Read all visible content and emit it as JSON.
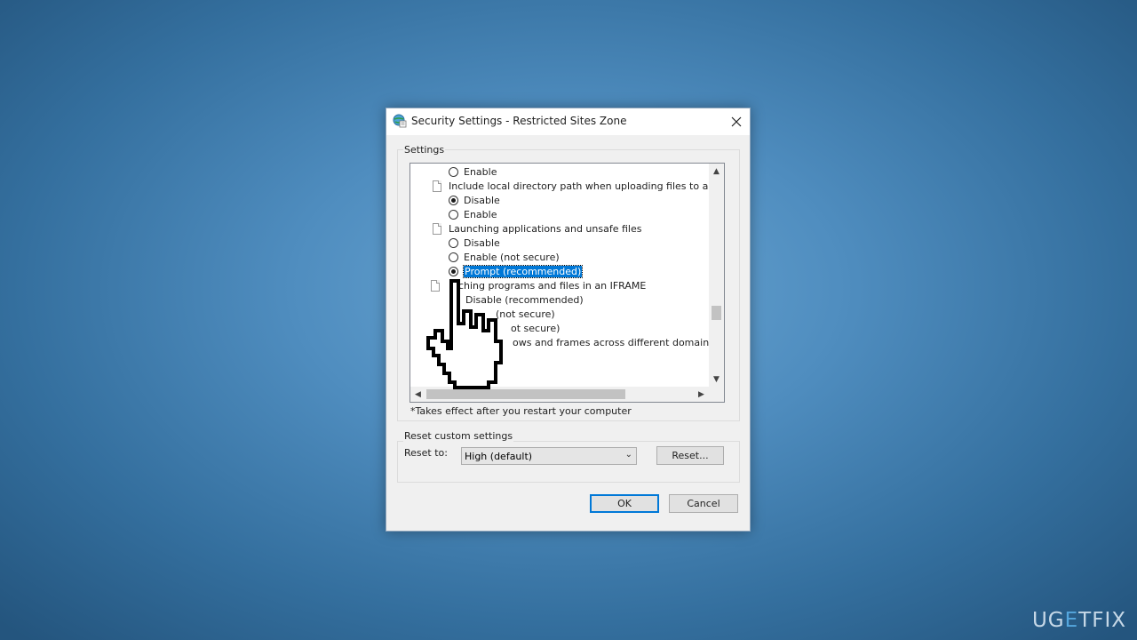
{
  "window": {
    "title": "Security Settings - Restricted Sites Zone"
  },
  "settings_group": {
    "label": "Settings",
    "items": [
      {
        "type": "option",
        "label": "Enable",
        "checked": false
      },
      {
        "type": "category",
        "label": "Include local directory path when uploading files to a server"
      },
      {
        "type": "option",
        "label": "Disable",
        "checked": true
      },
      {
        "type": "option",
        "label": "Enable",
        "checked": false
      },
      {
        "type": "category",
        "label": "Launching applications and unsafe files"
      },
      {
        "type": "option",
        "label": "Disable",
        "checked": false
      },
      {
        "type": "option",
        "label": "Enable (not secure)",
        "checked": false
      },
      {
        "type": "option",
        "label": "Prompt (recommended)",
        "checked": true,
        "selected": true
      },
      {
        "type": "category",
        "label": "Launching programs and files in an IFRAME"
      },
      {
        "type": "option",
        "label": "Disable (recommended)",
        "checked": false
      },
      {
        "type": "option",
        "label": "Enable (not secure)",
        "checked": false
      },
      {
        "type": "option",
        "label": "Prompt (not secure)",
        "checked": false
      },
      {
        "type": "category",
        "label": "Navigate windows and frames across different domains"
      }
    ],
    "visible_text": {
      "item_8": "nching programs and files in an IFRAME",
      "item_9": "Disable (recommended)",
      "item_10": "(not secure)",
      "item_11": "ot secure)",
      "item_12": "ows and frames across different domains"
    },
    "footnote": "*Takes effect after you restart your computer"
  },
  "reset_group": {
    "label": "Reset custom settings",
    "reset_to_label": "Reset to:",
    "selected_level": "High (default)",
    "reset_button": "Reset..."
  },
  "buttons": {
    "ok": "OK",
    "cancel": "Cancel"
  },
  "watermark": {
    "left": "UG",
    "accent": "E",
    "right": "TFIX"
  },
  "colors": {
    "selection": "#0078d7",
    "default_button_border": "#0078d7"
  }
}
